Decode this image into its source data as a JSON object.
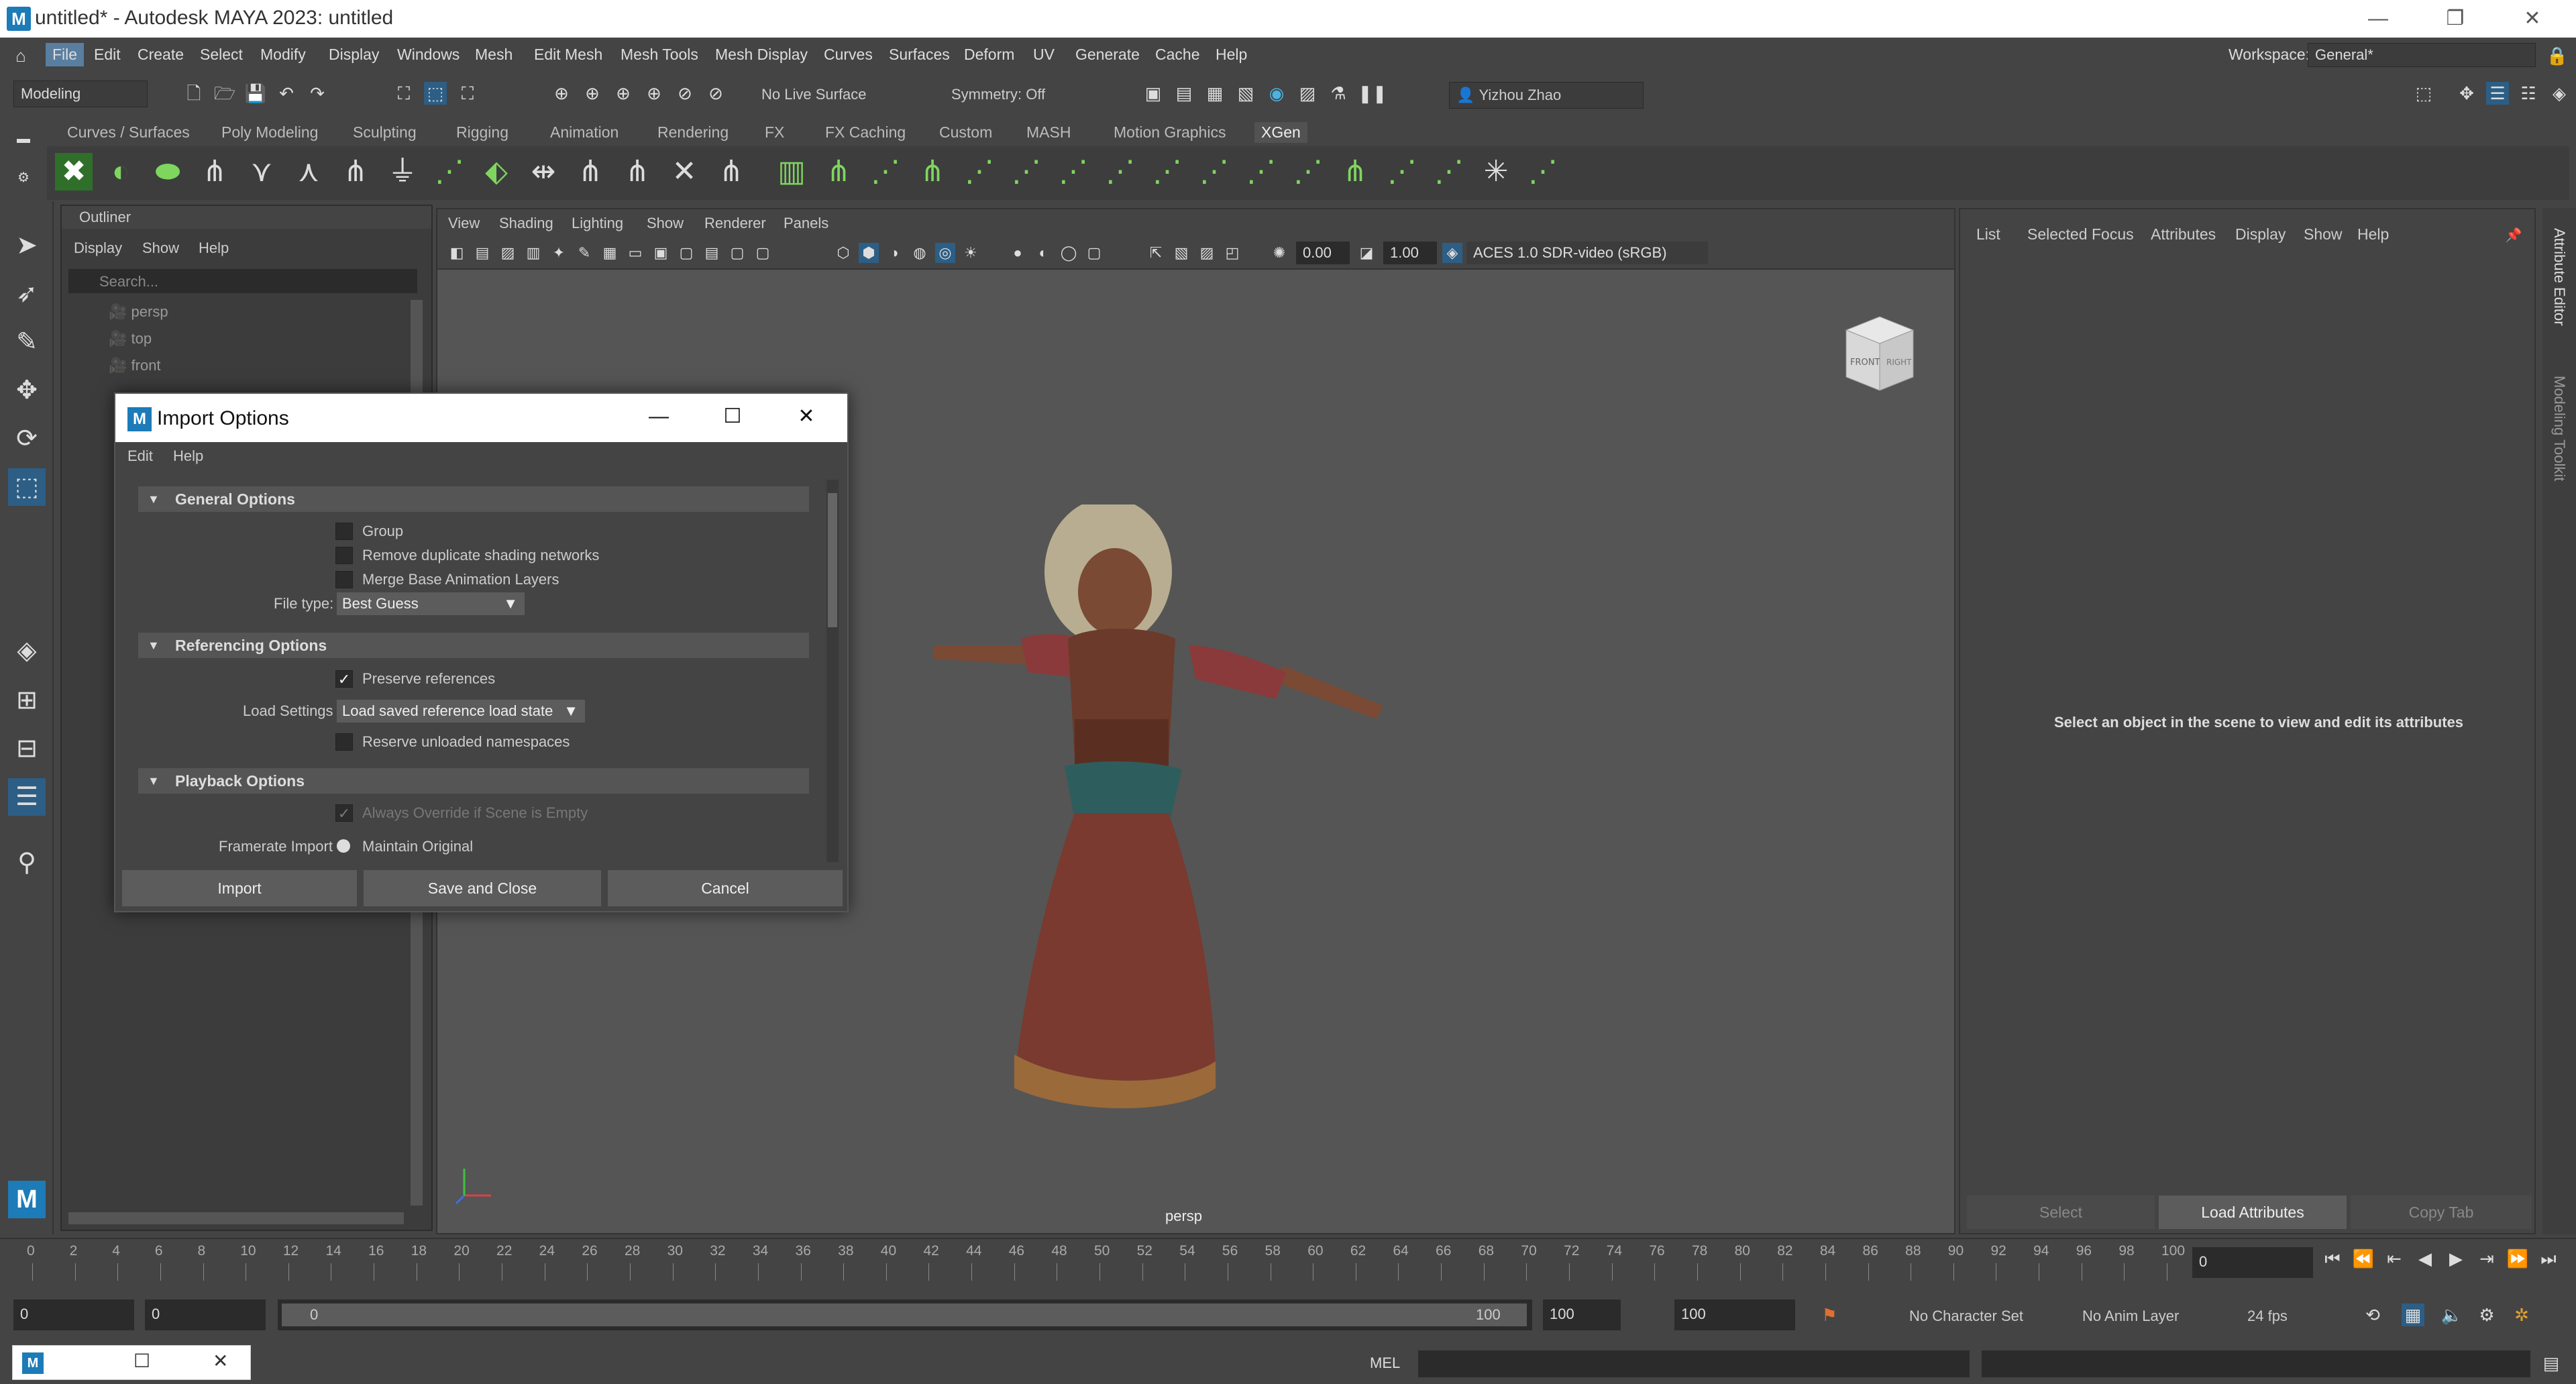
{
  "app": {
    "logo_letter": "M",
    "window_title": "untitled* - Autodesk MAYA 2023: untitled",
    "win_controls": [
      "—",
      "❐",
      "✕"
    ]
  },
  "menubar": {
    "items": [
      "File",
      "Edit",
      "Create",
      "Select",
      "Modify",
      "Display",
      "Windows",
      "Mesh",
      "Edit Mesh",
      "Mesh Tools",
      "Mesh Display",
      "Curves",
      "Surfaces",
      "Deform",
      "UV",
      "Generate",
      "Cache",
      "Help"
    ],
    "workspace_label": "Workspace:",
    "workspace_value": "General*"
  },
  "toolbar": {
    "mode": "Modeling",
    "live_surface": "No Live Surface",
    "symmetry": "Symmetry: Off",
    "user": "Yizhou Zhao"
  },
  "shelf": {
    "tabs": [
      "Curves / Surfaces",
      "Poly Modeling",
      "Sculpting",
      "Rigging",
      "Animation",
      "Rendering",
      "FX",
      "FX Caching",
      "Custom",
      "MASH",
      "Motion Graphics",
      "XGen"
    ],
    "active_tab": "XGen"
  },
  "outliner": {
    "title": "Outliner",
    "menu": [
      "Display",
      "Show",
      "Help"
    ],
    "search_placeholder": "Search...",
    "rows": [
      "persp",
      "top",
      "front"
    ]
  },
  "viewport": {
    "menu": [
      "View",
      "Shading",
      "Lighting",
      "Show",
      "Renderer",
      "Panels"
    ],
    "exposure": "0.00",
    "gamma": "1.00",
    "color_space": "ACES 1.0 SDR-video (sRGB)",
    "camera_label": "persp",
    "viewcube_front": "FRONT",
    "viewcube_right": "RIGHT"
  },
  "attribute_editor": {
    "menu": [
      "List",
      "Selected",
      "Focus",
      "Attributes",
      "Display",
      "Show",
      "Help"
    ],
    "message": "Select an object in the scene to view and edit its attributes",
    "buttons": [
      "Select",
      "Load Attributes",
      "Copy Tab"
    ],
    "side_tabs": [
      "Attribute Editor",
      "Modeling Toolkit"
    ]
  },
  "dialog": {
    "title": "Import Options",
    "menu": [
      "Edit",
      "Help"
    ],
    "sections": {
      "general": "General Options",
      "referencing": "Referencing Options",
      "playback": "Playback Options"
    },
    "group_label": "Group",
    "remove_dup_label": "Remove duplicate shading networks",
    "merge_layers_label": "Merge Base Animation Layers",
    "file_type_label": "File type:",
    "file_type_value": "Best Guess",
    "preserve_refs_label": "Preserve references",
    "preserve_refs_checked": true,
    "load_settings_label": "Load Settings",
    "load_settings_value": "Load saved reference load state",
    "reserve_ns_label": "Reserve unloaded namespaces",
    "override_label": "Always Override if Scene is Empty",
    "framerate_label": "Framerate Import",
    "framerate_value": "Maintain Original",
    "buttons": {
      "import": "Import",
      "save_close": "Save and Close",
      "cancel": "Cancel"
    }
  },
  "timeline": {
    "ticks": [
      "0",
      "2",
      "4",
      "6",
      "8",
      "10",
      "12",
      "14",
      "16",
      "18",
      "20",
      "22",
      "24",
      "26",
      "28",
      "30",
      "32",
      "34",
      "36",
      "38",
      "40",
      "42",
      "44",
      "46",
      "48",
      "50",
      "52",
      "54",
      "56",
      "58",
      "60",
      "62",
      "64",
      "66",
      "68",
      "70",
      "72",
      "74",
      "76",
      "78",
      "80",
      "82",
      "84",
      "86",
      "88",
      "90",
      "92",
      "94",
      "96",
      "98",
      "100"
    ],
    "current_frame": "0"
  },
  "range": {
    "start": "0",
    "anim_start": "0",
    "range_start": "0",
    "range_end_inner": "100",
    "range_end": "100",
    "anim_end": "100",
    "character_set": "No Character Set",
    "anim_layer": "No Anim Layer",
    "fps": "24 fps"
  },
  "cmdline": {
    "language": "MEL"
  },
  "colors": {
    "accent": "#2d5e85",
    "shelf_icon": "#7fd65f",
    "maya_blue": "#1d7bb8"
  }
}
